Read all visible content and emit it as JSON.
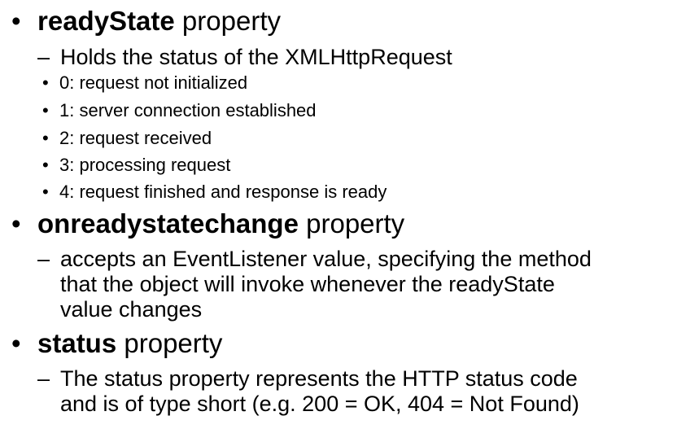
{
  "items": [
    {
      "term": "readyState",
      "suffix": " property",
      "sub": "Holds the status of the XMLHttpRequest",
      "states": [
        "0: request not initialized",
        "1: server connection established",
        "2: request received",
        "3: processing request",
        "4: request finished and response is ready"
      ]
    },
    {
      "term": "onreadystatechange",
      "suffix": " property",
      "sub_lines": [
        "accepts an EventListener value, specifying the method",
        "that the object will invoke whenever the readyState",
        "value changes"
      ]
    },
    {
      "term": "status",
      "suffix": " property",
      "sub_lines": [
        "The status property represents the HTTP status code",
        "and is of type short (e.g. 200 = OK, 404 = Not Found)"
      ]
    }
  ],
  "symbols": {
    "bullet": "•",
    "dash": "–"
  }
}
